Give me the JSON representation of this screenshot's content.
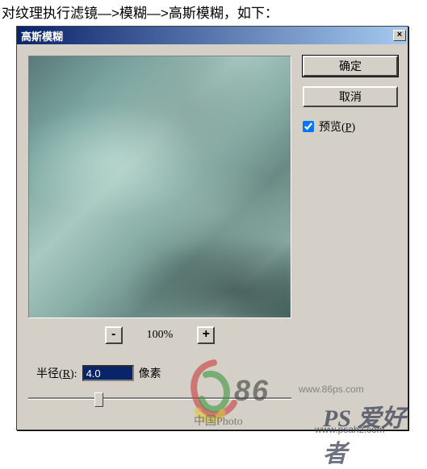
{
  "instruction": "对纹理执行滤镜—>模糊—>高斯模糊，如下：",
  "dialog": {
    "title": "高斯模糊",
    "close_icon": "×",
    "buttons": {
      "ok": "确定",
      "cancel": "取消"
    },
    "preview": {
      "checked": true,
      "label_pre": "预览(",
      "label_key": "P",
      "label_post": ")"
    },
    "zoom": {
      "minus": "-",
      "plus": "+",
      "level": "100%"
    },
    "radius": {
      "label_pre": "半径(",
      "label_key": "R",
      "label_post": "):",
      "value": "4.0",
      "unit": "像素"
    }
  },
  "watermark": {
    "logo1_text": "86",
    "logo1_url": "www.86ps.com",
    "logo1_cn": "中国Photo",
    "logo2_text": "PS 爱好者",
    "logo2_url": "www.psahz.com"
  }
}
